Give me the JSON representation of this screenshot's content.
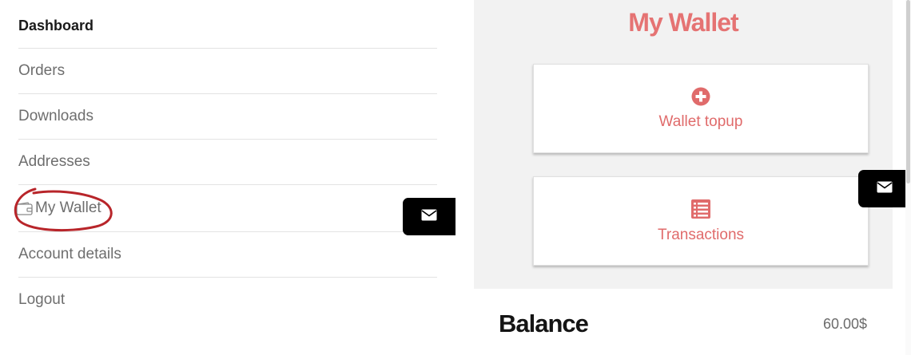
{
  "account_nav": {
    "items": [
      {
        "label": "Dashboard"
      },
      {
        "label": "Orders"
      },
      {
        "label": "Downloads"
      },
      {
        "label": "Addresses"
      },
      {
        "label": "My Wallet"
      },
      {
        "label": "Account details"
      },
      {
        "label": "Logout"
      }
    ],
    "active_label": "Dashboard"
  },
  "wallet": {
    "title": "My Wallet",
    "topup_label": "Wallet topup",
    "transactions_label": "Transactions",
    "balance_label": "Balance",
    "balance_value": "60.00$"
  },
  "icons": {
    "topup": "plus-circle-icon",
    "transactions": "list-icon",
    "contact": "envelope-icon",
    "wallet": "wallet-icon"
  },
  "colors": {
    "accent": "#e57373",
    "annotation_circle": "#b8252a",
    "contact_button": "#000000"
  }
}
